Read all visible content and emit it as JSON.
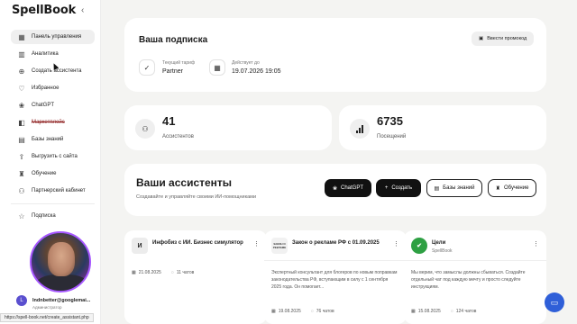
{
  "brand": {
    "logo": "SpellBook"
  },
  "sidebar": {
    "items": [
      {
        "label": "Панель управления",
        "icon": "grid-icon"
      },
      {
        "label": "Аналитика",
        "icon": "chart-icon"
      },
      {
        "label": "Создать ассистента",
        "icon": "plus-circle-icon"
      },
      {
        "label": "Избранное",
        "icon": "heart-icon"
      },
      {
        "label": "ChatGPT",
        "icon": "openai-icon"
      },
      {
        "label": "Маркетплейс",
        "icon": "bag-icon"
      },
      {
        "label": "Базы знаний",
        "icon": "book-icon"
      },
      {
        "label": "Выгрузить с сайта",
        "icon": "upload-icon"
      },
      {
        "label": "Обучение",
        "icon": "cap-icon"
      },
      {
        "label": "Партнерский кабинет",
        "icon": "partner-icon"
      },
      {
        "label": "Подписка",
        "icon": "star-icon"
      }
    ],
    "user": {
      "initial": "L",
      "name": "lndnbetter@googlemai...",
      "role": "Администратор"
    }
  },
  "status_url": "https://spell-book.net/create_assistant.php",
  "subscription": {
    "title": "Ваша подписка",
    "promo_button": "Ввести промокод",
    "plan_label": "Текущий тариф",
    "plan_value": "Partner",
    "valid_label": "Действует до",
    "valid_value": "19.07.2026 19:05"
  },
  "stats": {
    "assistants": {
      "value": "41",
      "label": "Ассистентов"
    },
    "visits": {
      "value": "6735",
      "label": "Посещений"
    }
  },
  "assistants_section": {
    "title": "Ваши ассистенты",
    "subtitle": "Создавайте и управляйте своими ИИ-помощниками",
    "buttons": {
      "chatgpt": "ChatGPT",
      "create": "Создать",
      "kb": "Базы знаний",
      "learn": "Обучение"
    }
  },
  "cards": [
    {
      "thumb": "И",
      "name": "Инфобиз с ИИ. Бизнес симулятор",
      "author": "",
      "date": "21.08.2025",
      "chats": "11 чатов",
      "desc": ""
    },
    {
      "thumb": "ЗАКОН О РЕКЛАМЕ",
      "name": "Закон о рекламе РФ с 01.09.2025",
      "author": "",
      "desc": "Экспертный консультант для блогеров по новым поправкам законодательства РФ, вступающим в силу с 1 сентября 2025 года. Он помогает...",
      "date": "19.08.2025",
      "chats": "76 чатов"
    },
    {
      "thumb": "✔",
      "name": "Цели",
      "author": "SpellBook",
      "desc": "Мы верим, что замыслы должны сбываться. Создайте отдельный чат под каждую мечту и просто следуйте инструкциям.",
      "date": "15.08.2025",
      "chats": "124 чатов"
    }
  ],
  "colors": {
    "accent": "#a657ff",
    "fab": "#2f5fd8",
    "check": "#2ea043"
  }
}
